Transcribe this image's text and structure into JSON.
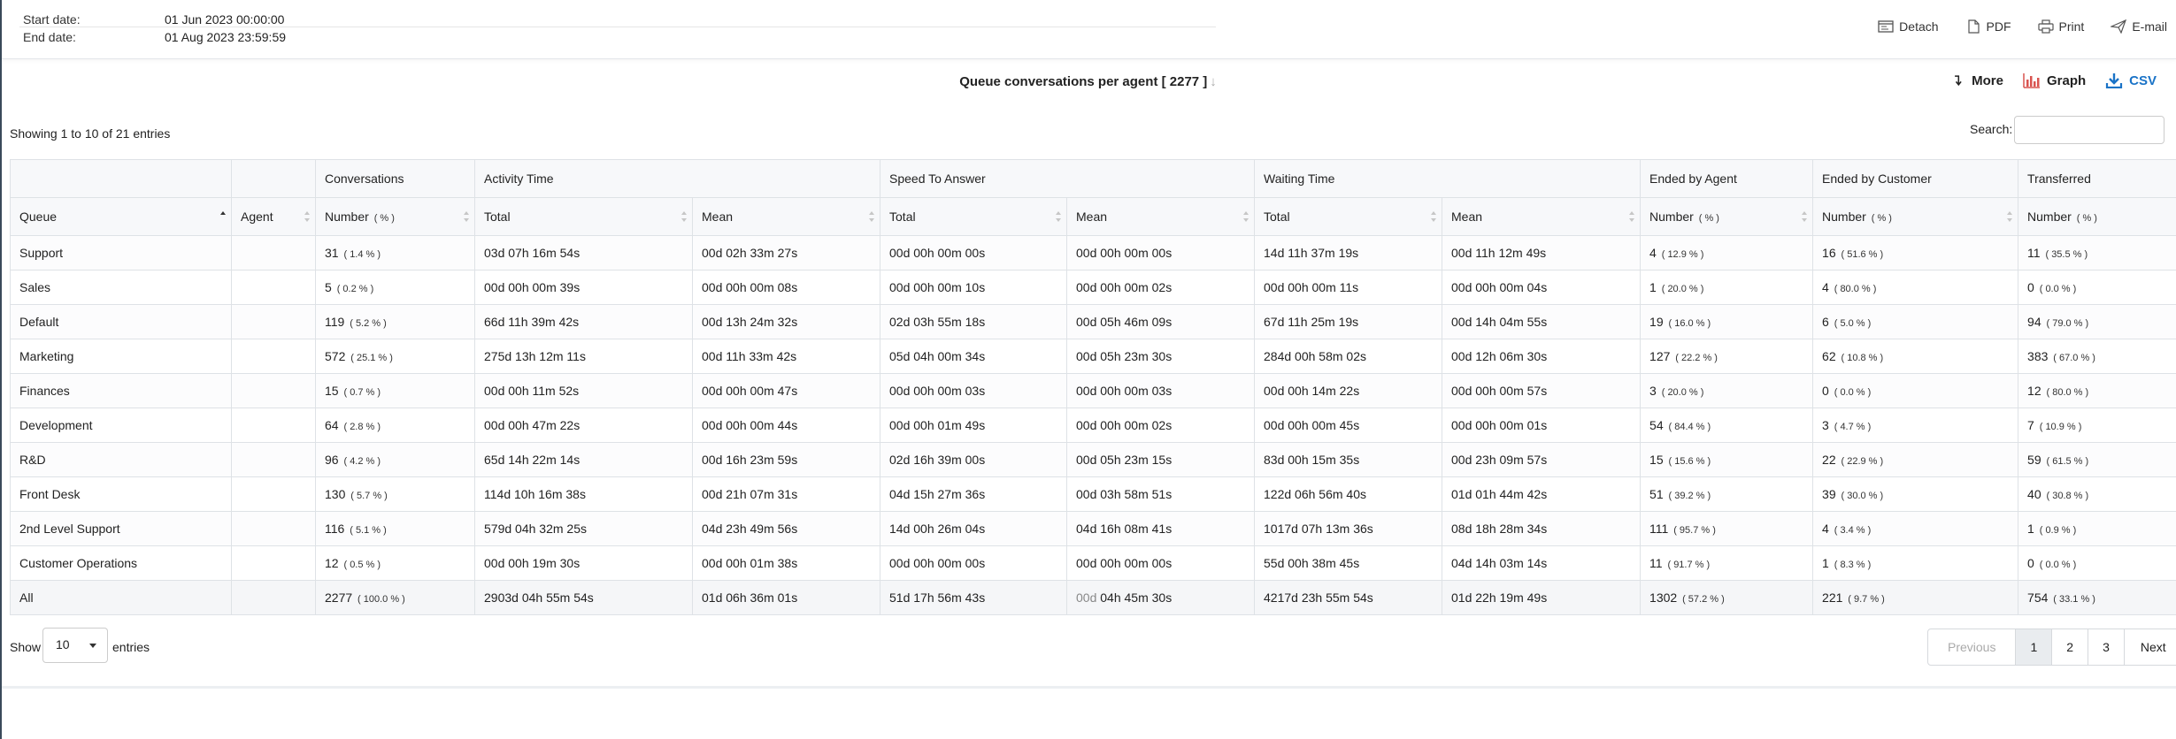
{
  "header": {
    "start_label": "Start date:",
    "start_value": "01 Jun 2023 00:00:00",
    "end_label": "End date:",
    "end_value": "01 Aug 2023 23:59:59",
    "actions": [
      "Detach",
      "PDF",
      "Print",
      "E-mail"
    ]
  },
  "report": {
    "title": "Queue conversations per agent [ 2277 ]",
    "actions": [
      "More",
      "Graph",
      "CSV"
    ]
  },
  "table_info": {
    "showing": "Showing 1 to 10 of 21 entries",
    "search_label": "Search:",
    "search_value": ""
  },
  "colors": {
    "graph_icon": "#d9534f",
    "csv_link": "#1a73c7"
  },
  "table": {
    "group_headers": [
      "",
      "",
      "Conversations",
      "Activity Time",
      "Speed To Answer",
      "Waiting Time",
      "Ended by Agent",
      "Ended by Customer",
      "Transferred"
    ],
    "columns": [
      "Queue",
      "Agent",
      "Number",
      "( % )",
      "Total",
      "Mean",
      "Total",
      "Mean",
      "Total",
      "Mean",
      "Number",
      "( % )",
      "Number",
      "( % )",
      "Number",
      "( % )"
    ],
    "rows": [
      {
        "queue": "Support",
        "agent": "",
        "conv": "31",
        "conv_pct": "( 1.4 % )",
        "act_total": "03d 07h 16m 54s",
        "act_mean": "00d 02h 33m 27s",
        "sta_total": "00d 00h 00m 00s",
        "sta_mean": "00d 00h 00m 00s",
        "wait_total": "14d 11h 37m 19s",
        "wait_mean": "00d 11h 12m 49s",
        "eba": "4",
        "eba_pct": "( 12.9 % )",
        "ebc": "16",
        "ebc_pct": "( 51.6 % )",
        "tr": "11",
        "tr_pct": "( 35.5 % )"
      },
      {
        "queue": "Sales",
        "agent": "",
        "conv": "5",
        "conv_pct": "( 0.2 % )",
        "act_total": "00d 00h 00m 39s",
        "act_mean": "00d 00h 00m 08s",
        "sta_total": "00d 00h 00m 10s",
        "sta_mean": "00d 00h 00m 02s",
        "wait_total": "00d 00h 00m 11s",
        "wait_mean": "00d 00h 00m 04s",
        "eba": "1",
        "eba_pct": "( 20.0 % )",
        "ebc": "4",
        "ebc_pct": "( 80.0 % )",
        "tr": "0",
        "tr_pct": "( 0.0 % )"
      },
      {
        "queue": "Default",
        "agent": "",
        "conv": "119",
        "conv_pct": "( 5.2 % )",
        "act_total": "66d 11h 39m 42s",
        "act_mean": "00d 13h 24m 32s",
        "sta_total": "02d 03h 55m 18s",
        "sta_mean": "00d 05h 46m 09s",
        "wait_total": "67d 11h 25m 19s",
        "wait_mean": "00d 14h 04m 55s",
        "eba": "19",
        "eba_pct": "( 16.0 % )",
        "ebc": "6",
        "ebc_pct": "( 5.0 % )",
        "tr": "94",
        "tr_pct": "( 79.0 % )"
      },
      {
        "queue": "Marketing",
        "agent": "",
        "conv": "572",
        "conv_pct": "( 25.1 % )",
        "act_total": "275d 13h 12m 11s",
        "act_mean": "00d 11h 33m 42s",
        "sta_total": "05d 04h 00m 34s",
        "sta_mean": "00d 05h 23m 30s",
        "wait_total": "284d 00h 58m 02s",
        "wait_mean": "00d 12h 06m 30s",
        "eba": "127",
        "eba_pct": "( 22.2 % )",
        "ebc": "62",
        "ebc_pct": "( 10.8 % )",
        "tr": "383",
        "tr_pct": "( 67.0 % )"
      },
      {
        "queue": "Finances",
        "agent": "",
        "conv": "15",
        "conv_pct": "( 0.7 % )",
        "act_total": "00d 00h 11m 52s",
        "act_mean": "00d 00h 00m 47s",
        "sta_total": "00d 00h 00m 03s",
        "sta_mean": "00d 00h 00m 03s",
        "wait_total": "00d 00h 14m 22s",
        "wait_mean": "00d 00h 00m 57s",
        "eba": "3",
        "eba_pct": "( 20.0 % )",
        "ebc": "0",
        "ebc_pct": "( 0.0 % )",
        "tr": "12",
        "tr_pct": "( 80.0 % )"
      },
      {
        "queue": "Development",
        "agent": "",
        "conv": "64",
        "conv_pct": "( 2.8 % )",
        "act_total": "00d 00h 47m 22s",
        "act_mean": "00d 00h 00m 44s",
        "sta_total": "00d 00h 01m 49s",
        "sta_mean": "00d 00h 00m 02s",
        "wait_total": "00d 00h 00m 45s",
        "wait_mean": "00d 00h 00m 01s",
        "eba": "54",
        "eba_pct": "( 84.4 % )",
        "ebc": "3",
        "ebc_pct": "( 4.7 % )",
        "tr": "7",
        "tr_pct": "( 10.9 % )"
      },
      {
        "queue": "R&D",
        "agent": "",
        "conv": "96",
        "conv_pct": "( 4.2 % )",
        "act_total": "65d 14h 22m 14s",
        "act_mean": "00d 16h 23m 59s",
        "sta_total": "02d 16h 39m 00s",
        "sta_mean": "00d 05h 23m 15s",
        "wait_total": "83d 00h 15m 35s",
        "wait_mean": "00d 23h 09m 57s",
        "eba": "15",
        "eba_pct": "( 15.6 % )",
        "ebc": "22",
        "ebc_pct": "( 22.9 % )",
        "tr": "59",
        "tr_pct": "( 61.5 % )"
      },
      {
        "queue": "Front Desk",
        "agent": "",
        "conv": "130",
        "conv_pct": "( 5.7 % )",
        "act_total": "114d 10h 16m 38s",
        "act_mean": "00d 21h 07m 31s",
        "sta_total": "04d 15h 27m 36s",
        "sta_mean": "00d 03h 58m 51s",
        "wait_total": "122d 06h 56m 40s",
        "wait_mean": "01d 01h 44m 42s",
        "eba": "51",
        "eba_pct": "( 39.2 % )",
        "ebc": "39",
        "ebc_pct": "( 30.0 % )",
        "tr": "40",
        "tr_pct": "( 30.8 % )"
      },
      {
        "queue": "2nd Level Support",
        "agent": "",
        "conv": "116",
        "conv_pct": "( 5.1 % )",
        "act_total": "579d 04h 32m 25s",
        "act_mean": "04d 23h 49m 56s",
        "sta_total": "14d 00h 26m 04s",
        "sta_mean": "04d 16h 08m 41s",
        "wait_total": "1017d 07h 13m 36s",
        "wait_mean": "08d 18h 28m 34s",
        "eba": "111",
        "eba_pct": "( 95.7 % )",
        "ebc": "4",
        "ebc_pct": "( 3.4 % )",
        "tr": "1",
        "tr_pct": "( 0.9 % )"
      },
      {
        "queue": "Customer Operations",
        "agent": "",
        "conv": "12",
        "conv_pct": "( 0.5 % )",
        "act_total": "00d 00h 19m 30s",
        "act_mean": "00d 00h 01m 38s",
        "sta_total": "00d 00h 00m 00s",
        "sta_mean": "00d 00h 00m 00s",
        "wait_total": "55d 00h 38m 45s",
        "wait_mean": "04d 14h 03m 14s",
        "eba": "11",
        "eba_pct": "( 91.7 % )",
        "ebc": "1",
        "ebc_pct": "( 8.3 % )",
        "tr": "0",
        "tr_pct": "( 0.0 % )"
      }
    ],
    "total": {
      "queue": "All",
      "agent": "",
      "conv": "2277",
      "conv_pct": "( 100.0 % )",
      "act_total": "2903d 04h 55m 54s",
      "act_mean": "01d 06h 36m 01s",
      "sta_total": "51d 17h 56m 43s",
      "sta_mean_dim": "00d",
      "sta_mean": "04h 45m 30s",
      "wait_total": "4217d 23h 55m 54s",
      "wait_mean": "01d 22h 19m 49s",
      "eba": "1302",
      "eba_pct": "( 57.2 % )",
      "ebc": "221",
      "ebc_pct": "( 9.7 % )",
      "tr": "754",
      "tr_pct": "( 33.1 % )"
    }
  },
  "footer": {
    "show_label": "Show",
    "length_value": "10",
    "entries_label": "entries",
    "pager": [
      "Previous",
      "1",
      "2",
      "3",
      "Next"
    ]
  }
}
